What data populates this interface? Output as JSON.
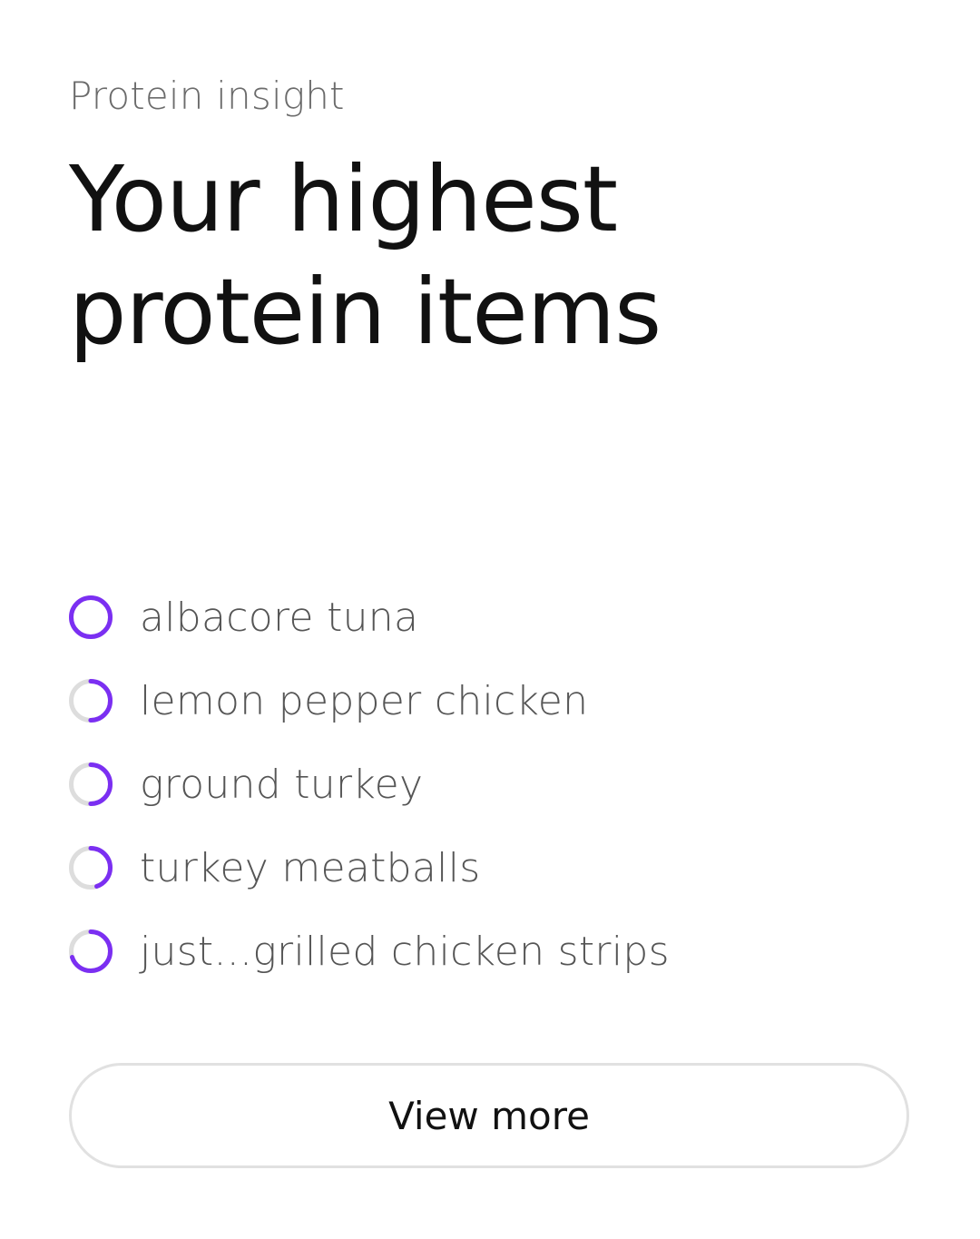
{
  "header": {
    "eyebrow": "Protein insight",
    "title_line1": "Your highest",
    "title_line2": "protein items"
  },
  "colors": {
    "accent": "#7b2ff2",
    "ring_track": "#dddddd",
    "label": "#555555"
  },
  "items": [
    {
      "label": "albacore tuna",
      "protein_fraction": 1.0
    },
    {
      "label": "lemon pepper chicken",
      "protein_fraction": 0.5
    },
    {
      "label": "ground turkey",
      "protein_fraction": 0.5
    },
    {
      "label": "turkey meatballs",
      "protein_fraction": 0.45
    },
    {
      "label": "just...grilled chicken strips",
      "protein_fraction": 0.7
    }
  ],
  "actions": {
    "view_more_label": "View more"
  }
}
